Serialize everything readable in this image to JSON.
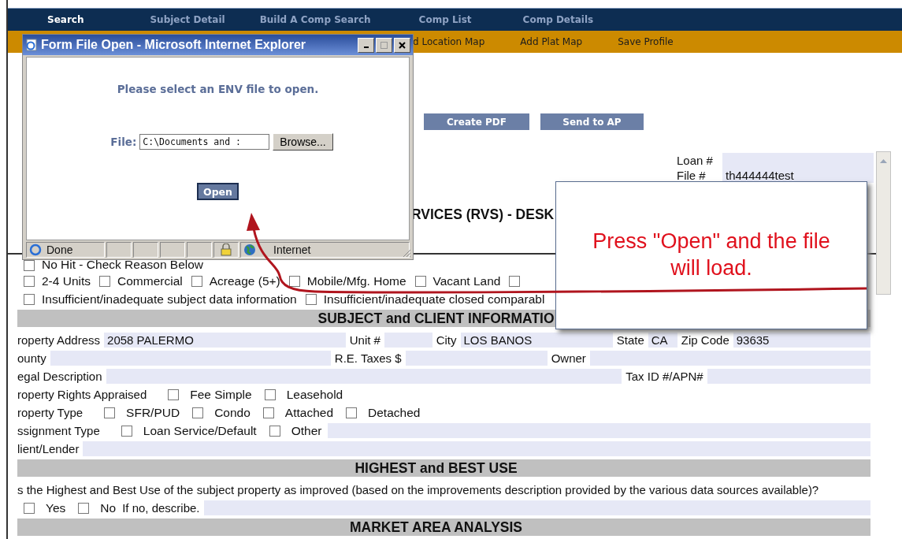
{
  "nav": [
    {
      "label": "Search",
      "selected": true
    },
    {
      "label": "Subject Detail",
      "selected": false
    },
    {
      "label": "Build A Comp Search",
      "selected": false
    },
    {
      "label": "Comp List",
      "selected": false
    },
    {
      "label": "Comp Details",
      "selected": false
    }
  ],
  "subnav": [
    "d Location Map",
    "Add Plat Map",
    "Save Profile"
  ],
  "actions": [
    "Create PDF",
    "Send to AP"
  ],
  "loan_info": [
    {
      "label": "Loan #"
    },
    {
      "label": "File #",
      "value": "th444444test"
    }
  ],
  "form_title": "RVICES (RVS) - DESK",
  "no_hit": {
    "label": "No Hit - Check Reason Below",
    "checked": false
  },
  "reason_rows": [
    [
      {
        "label": "2-4 Units",
        "checked": false
      },
      {
        "label": "Commercial",
        "checked": false
      },
      {
        "label": "Acreage (5+)",
        "checked": false
      },
      {
        "label": "Mobile/Mfg. Home",
        "checked": false
      },
      {
        "label": "Vacant Land",
        "checked": false
      },
      {
        "checked": false
      }
    ],
    [
      {
        "label": "Insufficient/inadequate subject data information",
        "checked": false
      },
      {
        "label": "Insufficient/inadequate closed comparabl",
        "checked": false
      }
    ]
  ],
  "sections": [
    {
      "heading": "SUBJECT and CLIENT INFORMATIO",
      "rows": [
        [
          {
            "kind": "field",
            "label": "roperty Address",
            "value": "2058 PALERMO"
          },
          {
            "kind": "field",
            "label": "Unit #"
          },
          {
            "kind": "field",
            "label": "City",
            "value": "LOS BANOS"
          },
          {
            "kind": "field",
            "label": "State",
            "value": "CA"
          },
          {
            "kind": "field",
            "label": "Zip Code",
            "value": "93635"
          }
        ],
        [
          {
            "kind": "field",
            "label": "ounty"
          },
          {
            "kind": "field",
            "label": "R.E. Taxes $"
          },
          {
            "kind": "field",
            "label": "Owner"
          }
        ],
        [
          {
            "kind": "field",
            "label": "egal Description"
          },
          {
            "kind": "field",
            "label": "Tax ID #/APN#"
          }
        ],
        [
          {
            "kind": "text",
            "text": "roperty Rights Appraised"
          },
          {
            "kind": "checkbox",
            "label": "Fee Simple",
            "checked": false
          },
          {
            "kind": "checkbox",
            "label": "Leasehold",
            "checked": false
          }
        ],
        [
          {
            "kind": "text",
            "text": "roperty Type"
          },
          {
            "kind": "checkbox",
            "label": "SFR/PUD",
            "checked": false
          },
          {
            "kind": "checkbox",
            "label": "Condo",
            "checked": false
          },
          {
            "kind": "checkbox",
            "label": "Attached",
            "checked": false
          },
          {
            "kind": "checkbox",
            "label": "Detached",
            "checked": false
          }
        ],
        [
          {
            "kind": "text",
            "text": "ssignment Type"
          },
          {
            "kind": "checkbox",
            "label": "Loan Service/Default",
            "checked": false
          },
          {
            "kind": "checkbox",
            "label": "Other",
            "checked": false
          },
          {
            "kind": "field"
          }
        ],
        [
          {
            "kind": "field",
            "label": "lient/Lender"
          }
        ]
      ]
    },
    {
      "heading": "HIGHEST and BEST USE",
      "rows": [
        [
          {
            "kind": "text",
            "text": "s the Highest and Best Use of the subject property as improved (based on the improvements description provided by the various data sources available)?"
          }
        ],
        [
          {
            "kind": "checkbox",
            "label": "Yes",
            "checked": false
          },
          {
            "kind": "checkbox",
            "label": "No",
            "checked": false
          },
          {
            "kind": "field",
            "label": "If no, describe."
          }
        ]
      ]
    },
    {
      "heading": "MARKET AREA ANALYSIS"
    }
  ],
  "popup": {
    "title": "Form File Open - Microsoft Internet Explorer",
    "message": "Please select an ENV file to open.",
    "file_label": "File:",
    "file_value": "C:\\Documents and :",
    "browse": "Browse...",
    "open": "Open",
    "status": "Done",
    "zone": "Internet"
  },
  "callout": {
    "text": "Press \"Open\" and the file will load."
  }
}
